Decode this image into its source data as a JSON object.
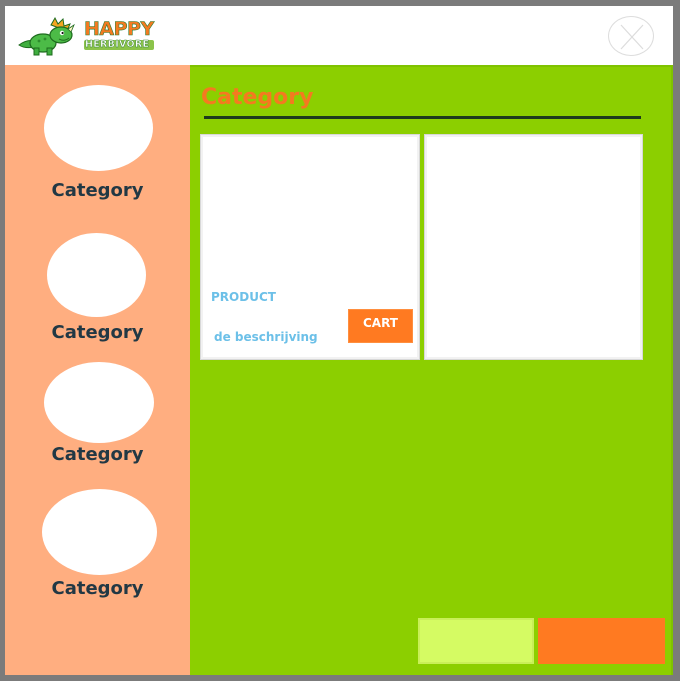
{
  "header": {
    "logo": {
      "line1": "HAPPY",
      "line2": "HERBIVORE"
    },
    "close_icon": "circle-x-icon"
  },
  "sidebar": {
    "items": [
      {
        "label": "Category"
      },
      {
        "label": "Category"
      },
      {
        "label": "Category"
      },
      {
        "label": "Category"
      }
    ]
  },
  "main": {
    "title": "Category",
    "cards": [
      {
        "product_name": "PRODUCT",
        "description": "de beschrijving",
        "cart_label": "CART"
      },
      {}
    ],
    "footer_buttons": {
      "secondary_label": "",
      "primary_label": ""
    }
  },
  "colors": {
    "accent_orange": "#ff7a21",
    "sidebar_peach": "#ffae80",
    "main_green": "#8ccf00",
    "text_blue": "#6cc0e8",
    "label_dark": "#223844",
    "light_green_button": "#d5fb63"
  }
}
